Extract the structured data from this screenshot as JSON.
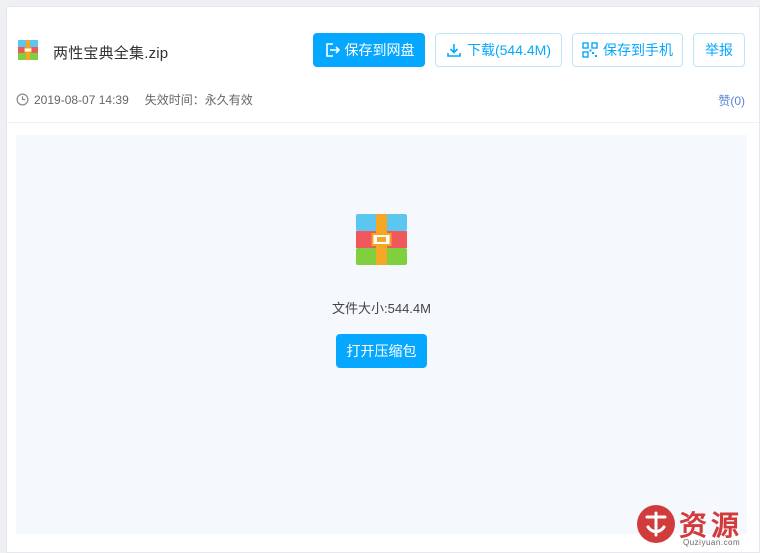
{
  "file": {
    "name": "两性宝典全集.zip",
    "date": "2019-08-07 14:39",
    "expire": "失效时间：永久有效",
    "like": "赞(0)"
  },
  "toolbar": {
    "save_label": "保存到网盘",
    "download_label": "下载(544.4M)",
    "phone_label": "保存到手机",
    "report_label": "举报"
  },
  "preview": {
    "size_text": "文件大小:544.4M",
    "open_label": "打开压缩包"
  },
  "watermark": {
    "text": "资源",
    "sub": "Quziyuan.com"
  },
  "colors": {
    "accent": "#06a7ff",
    "like": "#5b83d6",
    "preview_bg": "#f5f9fd"
  },
  "icons": {
    "file": "zip-archive-icon",
    "save": "export-icon",
    "download": "download-icon",
    "phone": "qr-code-icon",
    "clock": "clock-icon"
  }
}
